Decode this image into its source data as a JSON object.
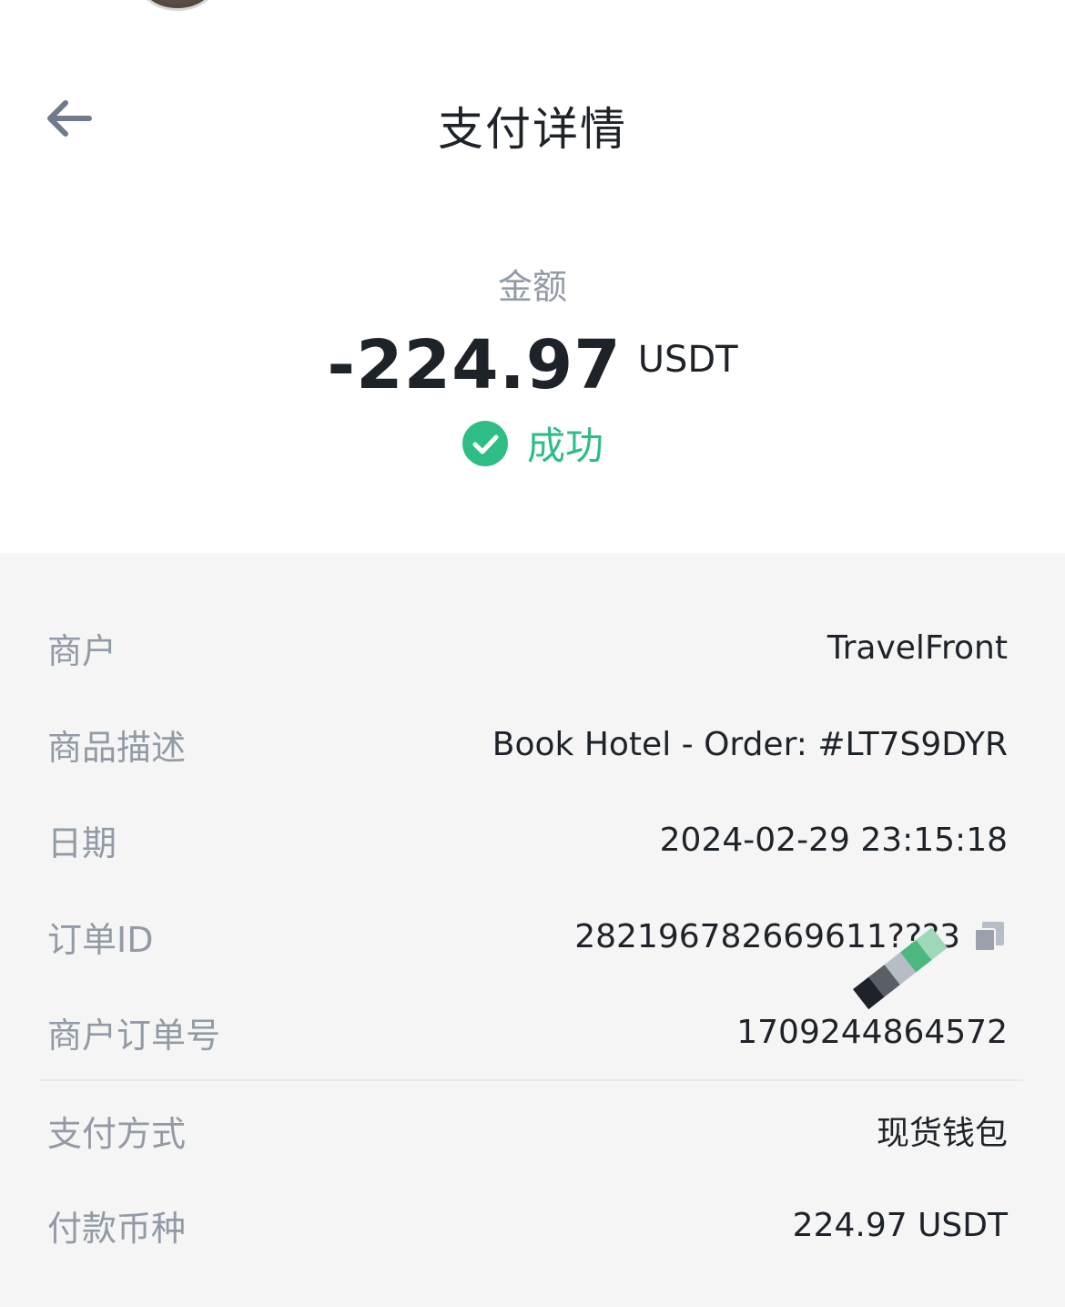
{
  "header": {
    "title": "支付详情",
    "back_icon": "back-arrow-icon"
  },
  "amount": {
    "label": "金额",
    "value": "-224.97",
    "unit": "USDT"
  },
  "status": {
    "text": "成功",
    "icon": "check-circle-icon",
    "color": "#2ebd85"
  },
  "details": [
    {
      "label": "商户",
      "value": "TravelFront"
    },
    {
      "label": "商品描述",
      "value": "Book Hotel - Order: #LT7S9DYR"
    },
    {
      "label": "日期",
      "value": "2024-02-29 23:15:18"
    },
    {
      "label": "订单ID",
      "value": "282196782669611???3",
      "icon": "copy-icon"
    },
    {
      "label": "商户订单号",
      "value": "1709244864572"
    },
    {
      "label": "支付方式",
      "value": "现货钱包"
    },
    {
      "label": "付款币种",
      "value": "224.97 USDT"
    }
  ],
  "colors": {
    "success": "#2ebd85",
    "label_gray": "#929aa5",
    "text_dark": "#1e2329",
    "panel_bg": "#f5f5f5"
  }
}
